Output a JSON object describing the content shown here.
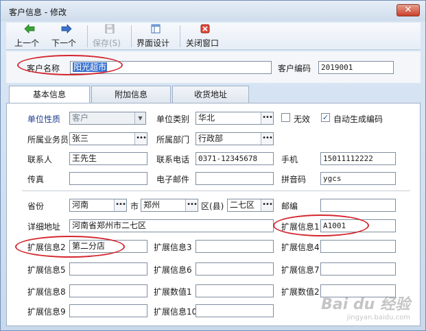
{
  "window": {
    "title": "客户信息 - 修改",
    "close_glyph": "✕"
  },
  "toolbar": {
    "prev": {
      "label": "上一个",
      "icon": "arrow-left-icon"
    },
    "next": {
      "label": "下一个",
      "icon": "arrow-right-icon"
    },
    "save": {
      "label": "保存(S)",
      "icon": "floppy-icon"
    },
    "design": {
      "label": "界面设计",
      "icon": "layout-icon"
    },
    "close": {
      "label": "关闭窗口",
      "icon": "close-window-icon"
    }
  },
  "header": {
    "customer_name_label": "客户名称",
    "customer_name_value": "阳光超市",
    "customer_code_label": "客户编码",
    "customer_code_value": "2019001"
  },
  "tabs": [
    {
      "label": "基本信息",
      "active": true
    },
    {
      "label": "附加信息",
      "active": false
    },
    {
      "label": "收货地址",
      "active": false
    }
  ],
  "basic": {
    "unit_nature_label": "单位性质",
    "unit_nature_value": "客户",
    "unit_category_label": "单位类别",
    "unit_category_value": "华北",
    "invalid_label": "无效",
    "invalid_checked": false,
    "auto_code_label": "自动生成编码",
    "auto_code_checked": true,
    "salesman_label": "所属业务员",
    "salesman_value": "张三",
    "department_label": "所属部门",
    "department_value": "行政部",
    "contact_label": "联系人",
    "contact_value": "王先生",
    "phone_label": "联系电话",
    "phone_value": "0371-12345678",
    "mobile_label": "手机",
    "mobile_value": "15011112222",
    "fax_label": "传真",
    "fax_value": "",
    "email_label": "电子邮件",
    "email_value": "",
    "pinyin_label": "拼音码",
    "pinyin_value": "ygcs"
  },
  "address": {
    "province_label": "省份",
    "province_value": "河南",
    "city_label": "市",
    "city_value": "郑州",
    "district_label": "区(县)",
    "district_value": "二七区",
    "postcode_label": "邮编",
    "postcode_value": "",
    "detail_label": "详细地址",
    "detail_value": "河南省郑州市二七区"
  },
  "ext": {
    "ext1_label": "扩展信息1",
    "ext1_value": "A1001",
    "ext2_label": "扩展信息2",
    "ext2_value": "第二分店",
    "ext3_label": "扩展信息3",
    "ext3_value": "",
    "ext4_label": "扩展信息4",
    "ext4_value": "",
    "ext5_label": "扩展信息5",
    "ext5_value": "",
    "ext6_label": "扩展信息6",
    "ext6_value": "",
    "ext7_label": "扩展信息7",
    "ext7_value": "",
    "ext8_label": "扩展信息8",
    "ext8_value": "",
    "num1_label": "扩展数值1",
    "num1_value": "",
    "num2_label": "扩展数值2",
    "num2_value": "",
    "ext9_label": "扩展信息9",
    "ext9_value": "",
    "ext10_label": "扩展信息10",
    "ext10_value": ""
  },
  "watermark": {
    "text": "Bai du 经验",
    "sub": "jingyan.baidu.com"
  },
  "colors": {
    "annotation_red": "#d4262e",
    "label_blue": "#1f3b8f",
    "selection_blue": "#3b74d0"
  }
}
